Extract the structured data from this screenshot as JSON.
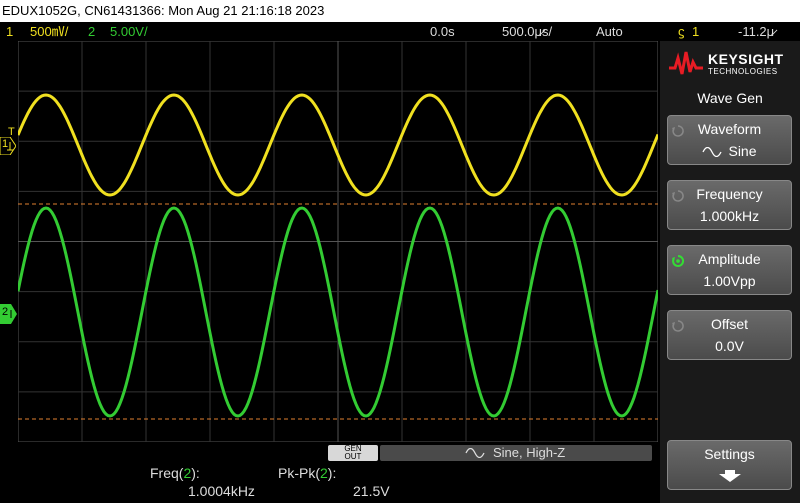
{
  "title_bar": "EDUX1052G, CN61431366: Mon Aug 21 21:16:18 2023",
  "status": {
    "ch1_num": "1",
    "ch1_scale": "500㎷/",
    "ch2_num": "2",
    "ch2_scale": "5.00V/",
    "time_delay": "0.0s",
    "time_scale": "500.0μ̷s/",
    "trigger_mode": "Auto",
    "trigger_symbol": "ϛ",
    "trigger_channel": "1",
    "trigger_level": "-11.2μ̷"
  },
  "markers": {
    "trigger_T": "T",
    "ch1_marker": "1",
    "ch2_marker": "2"
  },
  "waveforms": {
    "ch1_color": "#f0e020",
    "ch2_color": "#33cc33",
    "cursor_color": "#e08030"
  },
  "bottom": {
    "gen_badge_top": "GEN",
    "gen_badge_bottom": "OUT",
    "gen_status": "Sine, High-Z"
  },
  "measurements": {
    "freq_label": "Freq(",
    "freq_chan": "2",
    "freq_label_end": "):",
    "freq_value": "1.0004kHz",
    "pkpk_label": "Pk-Pk(",
    "pkpk_chan": "2",
    "pkpk_label_end": "):",
    "pkpk_value": "21.5V"
  },
  "sidebar": {
    "brand": "KEYSIGHT",
    "brand_sub": "TECHNOLOGIES",
    "menu_title": "Wave Gen",
    "softkeys": [
      {
        "label": "Waveform",
        "value": "Sine"
      },
      {
        "label": "Frequency",
        "value": "1.000kHz"
      },
      {
        "label": "Amplitude",
        "value": "1.00Vpp"
      },
      {
        "label": "Offset",
        "value": "0.0V"
      }
    ],
    "settings_label": "Settings"
  }
}
